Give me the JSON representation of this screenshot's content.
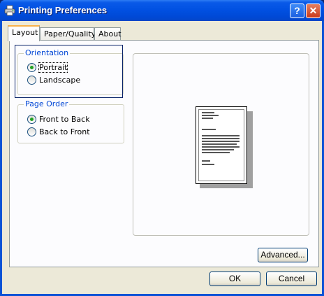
{
  "window": {
    "title": "Printing Preferences",
    "help_glyph": "?",
    "close_glyph": "✕"
  },
  "tabs": [
    {
      "label": "Layout",
      "active": true
    },
    {
      "label": "Paper/Quality",
      "active": false
    },
    {
      "label": "About",
      "active": false
    }
  ],
  "orientation": {
    "title": "Orientation",
    "options": [
      {
        "label": "Portrait",
        "selected": true
      },
      {
        "label": "Landscape",
        "selected": false
      }
    ]
  },
  "page_order": {
    "title": "Page Order",
    "options": [
      {
        "label": "Front to Back",
        "selected": true
      },
      {
        "label": "Back to Front",
        "selected": false
      }
    ]
  },
  "buttons": {
    "advanced": "Advanced...",
    "ok": "OK",
    "cancel": "Cancel"
  },
  "colors": {
    "titlebar": "#0151e2",
    "group_title": "#0046d5",
    "dialog_bg": "#ece9d8",
    "radio_selected": "#21a121"
  },
  "icons": {
    "title_icon": "printer-icon",
    "help": "help-icon",
    "close": "close-icon"
  }
}
